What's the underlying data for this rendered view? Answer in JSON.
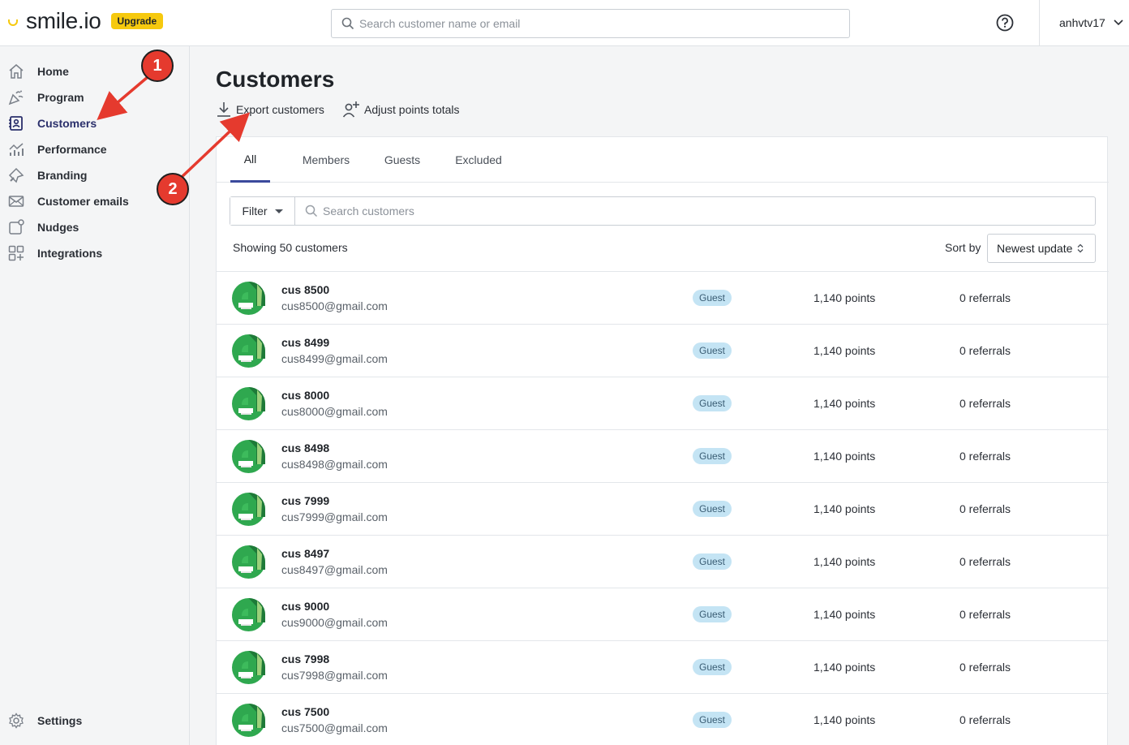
{
  "header": {
    "logo_text": "smile.io",
    "upgrade_label": "Upgrade",
    "search_placeholder": "Search customer name or email",
    "username": "anhvtv17"
  },
  "sidebar": {
    "items": [
      {
        "label": "Home",
        "icon": "home-icon"
      },
      {
        "label": "Program",
        "icon": "program-icon"
      },
      {
        "label": "Customers",
        "icon": "customers-icon",
        "active": true
      },
      {
        "label": "Performance",
        "icon": "performance-icon"
      },
      {
        "label": "Branding",
        "icon": "branding-icon"
      },
      {
        "label": "Customer emails",
        "icon": "envelope-icon"
      },
      {
        "label": "Nudges",
        "icon": "nudges-icon"
      },
      {
        "label": "Integrations",
        "icon": "integrations-icon"
      }
    ],
    "settings_label": "Settings"
  },
  "main": {
    "title": "Customers",
    "export_label": "Export customers",
    "adjust_label": "Adjust points totals",
    "tabs": [
      "All",
      "Members",
      "Guests",
      "Excluded"
    ],
    "active_tab": "All",
    "filter_label": "Filter",
    "list_search_placeholder": "Search customers",
    "showing_text": "Showing 50 customers",
    "sort_label": "Sort by",
    "sort_value": "Newest update",
    "customers": [
      {
        "name": "cus 8500",
        "email": "cus8500@gmail.com",
        "status": "Guest",
        "points": "1,140 points",
        "referrals": "0 referrals"
      },
      {
        "name": "cus 8499",
        "email": "cus8499@gmail.com",
        "status": "Guest",
        "points": "1,140 points",
        "referrals": "0 referrals"
      },
      {
        "name": "cus 8000",
        "email": "cus8000@gmail.com",
        "status": "Guest",
        "points": "1,140 points",
        "referrals": "0 referrals"
      },
      {
        "name": "cus 8498",
        "email": "cus8498@gmail.com",
        "status": "Guest",
        "points": "1,140 points",
        "referrals": "0 referrals"
      },
      {
        "name": "cus 7999",
        "email": "cus7999@gmail.com",
        "status": "Guest",
        "points": "1,140 points",
        "referrals": "0 referrals"
      },
      {
        "name": "cus 8497",
        "email": "cus8497@gmail.com",
        "status": "Guest",
        "points": "1,140 points",
        "referrals": "0 referrals"
      },
      {
        "name": "cus 9000",
        "email": "cus9000@gmail.com",
        "status": "Guest",
        "points": "1,140 points",
        "referrals": "0 referrals"
      },
      {
        "name": "cus 7998",
        "email": "cus7998@gmail.com",
        "status": "Guest",
        "points": "1,140 points",
        "referrals": "0 referrals"
      },
      {
        "name": "cus 7500",
        "email": "cus7500@gmail.com",
        "status": "Guest",
        "points": "1,140 points",
        "referrals": "0 referrals"
      }
    ]
  },
  "annotations": {
    "marker1": "1",
    "marker2": "2",
    "color": "#e53a2e"
  },
  "colors": {
    "brand_yellow": "#f6c90e",
    "guest_badge": "#c4e4f4",
    "active_tab": "#3b4a9c",
    "avatar_green": "#2fa84f"
  }
}
